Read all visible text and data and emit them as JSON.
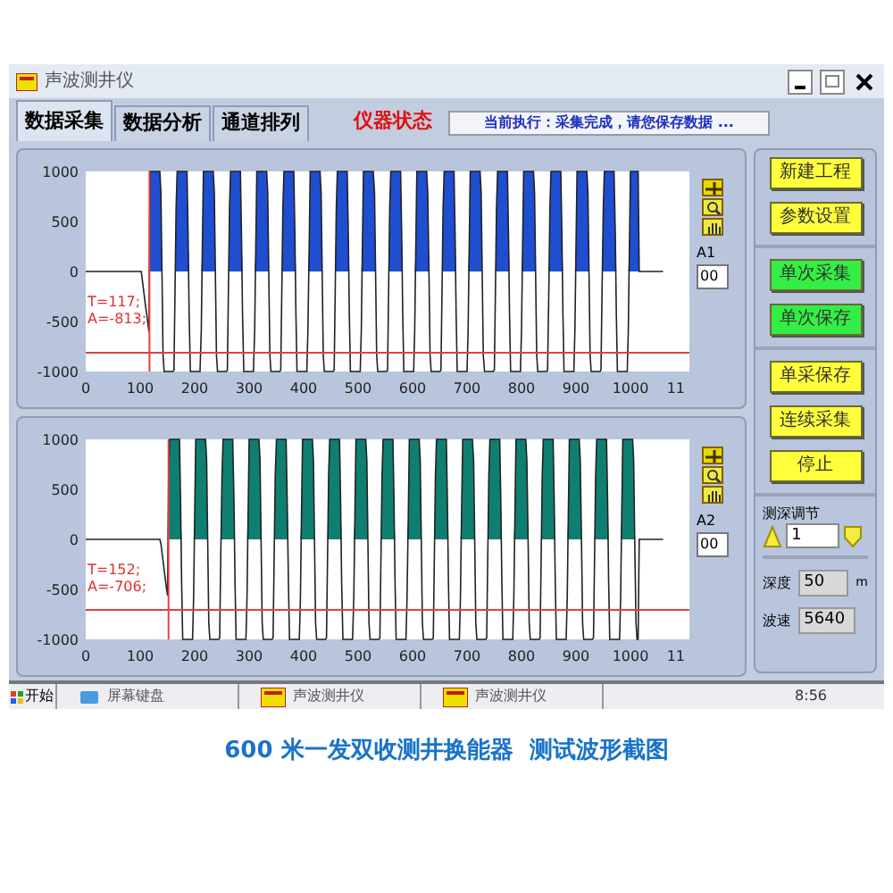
{
  "window": {
    "title": "声波测井仪"
  },
  "tabs": [
    {
      "label": "数据采集",
      "selected": true
    },
    {
      "label": "数据分析",
      "selected": false
    },
    {
      "label": "通道排列",
      "selected": false
    }
  ],
  "status": {
    "label": "仪器状态",
    "message": "当前执行：采集完成，请您保存数据 ..."
  },
  "channels": [
    {
      "name": "A1",
      "value": "00",
      "color": "#1f4fd0",
      "cursor_t": "T=117;",
      "cursor_a": "A=-813;",
      "y_ticks": [
        "1000",
        "500",
        "0",
        "-500",
        "-1000"
      ],
      "x_ticks": [
        "0",
        "100",
        "200",
        "300",
        "400",
        "500",
        "600",
        "700",
        "800",
        "900",
        "1000",
        "11"
      ]
    },
    {
      "name": "A2",
      "value": "00",
      "color": "#0f7f72",
      "cursor_t": "T=152;",
      "cursor_a": "A=-706;",
      "y_ticks": [
        "1000",
        "500",
        "0",
        "-500",
        "-1000"
      ],
      "x_ticks": [
        "0",
        "100",
        "200",
        "300",
        "400",
        "500",
        "600",
        "700",
        "800",
        "900",
        "1000",
        "11"
      ]
    }
  ],
  "button_groups": [
    [
      {
        "label": "新建工程",
        "color": "#ffff3c"
      },
      {
        "label": "参数设置",
        "color": "#ffff3c"
      }
    ],
    [
      {
        "label": "单次采集",
        "color": "#33ee44"
      },
      {
        "label": "单次保存",
        "color": "#33ee44"
      }
    ],
    [
      {
        "label": "单采保存",
        "color": "#ffff3c"
      },
      {
        "label": "连续采集",
        "color": "#ffff3c"
      },
      {
        "label": "停止",
        "color": "#ffff3c"
      }
    ]
  ],
  "adjust": {
    "label": "测深调节",
    "value": "1"
  },
  "depth": {
    "label": "深度",
    "value": "50",
    "unit": "m"
  },
  "speed": {
    "label": "波速",
    "value": "5640"
  },
  "taskbar": {
    "start": "开始",
    "items": [
      {
        "label": "屏幕键盘",
        "kind": "keyboard"
      },
      {
        "label": "声波测井仪",
        "kind": "app"
      },
      {
        "label": "声波测井仪",
        "kind": "app"
      }
    ],
    "clock": "8:56"
  },
  "caption": "600 米一发双收测井换能器  测试波形截图"
}
